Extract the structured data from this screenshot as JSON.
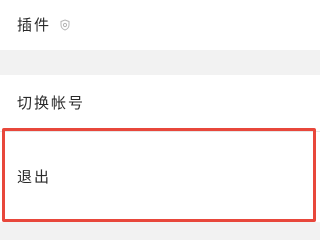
{
  "settings": {
    "items": [
      {
        "label": "插件",
        "icon": "settings-shield-icon"
      },
      {
        "label": "切换帐号"
      },
      {
        "label": "退出"
      }
    ]
  },
  "colors": {
    "background": "#f2f2f2",
    "row_background": "#ffffff",
    "text": "#2a2a2a",
    "icon": "#b5b5b5",
    "highlight": "#e8473b"
  }
}
